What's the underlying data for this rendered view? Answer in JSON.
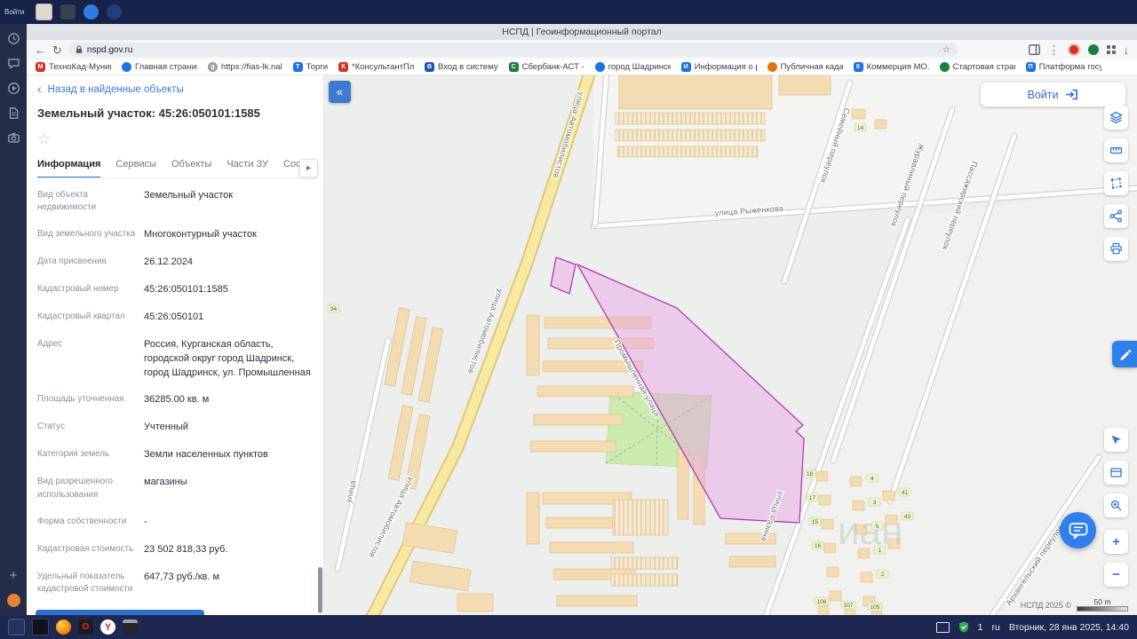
{
  "remote_bar": {
    "session_label": "Войти"
  },
  "browser": {
    "title": "НСПД | Геоинформационный портал",
    "url": "nspd.gov.ru",
    "bookmarks": [
      {
        "glyph": "M",
        "label": "ТехноКад-Муниц"
      },
      {
        "glyph": "",
        "label": "Главная страниц"
      },
      {
        "glyph": "g",
        "label": "https://fias-lk.nal"
      },
      {
        "glyph": "Т",
        "label": "Торги"
      },
      {
        "glyph": "К",
        "label": "*КонсультантПлю"
      },
      {
        "glyph": "В",
        "label": "Вход в систему"
      },
      {
        "glyph": "С",
        "label": "Сбербанк-АСТ -"
      },
      {
        "glyph": "",
        "label": "город Шадринск"
      },
      {
        "glyph": "И",
        "label": "Информация о р"
      },
      {
        "glyph": "",
        "label": "Публичная кадас"
      },
      {
        "glyph": "К",
        "label": "Коммерция МО."
      },
      {
        "glyph": "",
        "label": "Стартовая стран"
      },
      {
        "glyph": "П",
        "label": "Платформа госуд"
      }
    ]
  },
  "sidebar": {
    "back_link": "Назад в найденные объекты",
    "title": "Земельный участок: 45:26:050101:1585",
    "tabs": [
      {
        "label": "Информация"
      },
      {
        "label": "Сервисы"
      },
      {
        "label": "Объекты"
      },
      {
        "label": "Части ЗУ"
      },
      {
        "label": "Соста"
      }
    ],
    "fields": [
      {
        "label": "Вид объекта недвижимости",
        "value": "Земельный участок"
      },
      {
        "label": "Вид земельного участка",
        "value": "Многоконтурный участок"
      },
      {
        "label": "Дата присвоения",
        "value": "26.12.2024"
      },
      {
        "label": "Кадастровый номер",
        "value": "45:26:050101:1585"
      },
      {
        "label": "Кадастровый квартал",
        "value": "45:26:050101"
      },
      {
        "label": "Адрес",
        "value": "Россия, Курганская область, городской округ город Шадринск, город Шадринск, ул. Промышленная"
      },
      {
        "label": "Площадь уточненная",
        "value": "36285.00 кв. м"
      },
      {
        "label": "Статус",
        "value": "Учтенный"
      },
      {
        "label": "Категория земель",
        "value": "Земли населенных пунктов"
      },
      {
        "label": "Вид разрешенного использования",
        "value": "магазины"
      },
      {
        "label": "Форма собственности",
        "value": "-"
      },
      {
        "label": "Кадастровая стоимость",
        "value": "23 502 818,33 руб."
      },
      {
        "label": "Удельный показатель кадастровой стоимости",
        "value": "647,73 руб./кв. м"
      }
    ]
  },
  "map": {
    "collapse_glyph": "«",
    "login_label": "Войти",
    "copyright": "НСПД 2025 ©",
    "scale_label": "50 m",
    "watermark": "иан",
    "parcel_accent": "#b23ab2",
    "streets": {
      "avtomobilistov": "улица Автомобилистов",
      "ryzhenkova": "улица Рыженкова",
      "semeyny": "Семейный переулок",
      "zhuravliny": "Журавлиный переулок",
      "passazhirsky": "Пассажирский переулок",
      "promyshlennaya": "Промышленная улица",
      "razina": "улица Разина",
      "arkhangelsky": "Архангельский переулок",
      "ulitsa": "улица"
    },
    "house_numbers": [
      "14",
      "34",
      "18",
      "17",
      "15",
      "16",
      "4",
      "3",
      "5",
      "1",
      "2",
      "41",
      "43",
      "106",
      "107",
      "105"
    ]
  },
  "taskbar": {
    "lang": "ru",
    "notification_count": "1",
    "clock": "Вторник, 28 янв 2025, 14:40"
  }
}
